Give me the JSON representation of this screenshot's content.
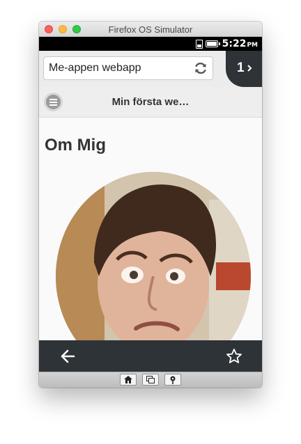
{
  "window": {
    "title": "Firefox OS Simulator"
  },
  "statusbar": {
    "time": "5:22",
    "ampm": "PM",
    "icons": [
      "sim-card-icon",
      "battery-icon"
    ]
  },
  "urlbar": {
    "value": "Me-appen webapp",
    "tab_count": "1"
  },
  "app": {
    "title": "Min första we…",
    "heading": "Om Mig"
  },
  "colors": {
    "dark_bar": "#2d3337",
    "content_bg": "#fafafa",
    "header_bg": "#eeeeee"
  },
  "bottombar": {
    "icons": [
      "back-arrow-icon",
      "star-icon"
    ]
  },
  "simulator_toolbar": {
    "buttons": [
      "home-icon",
      "windows-icon",
      "location-pin-icon"
    ]
  }
}
